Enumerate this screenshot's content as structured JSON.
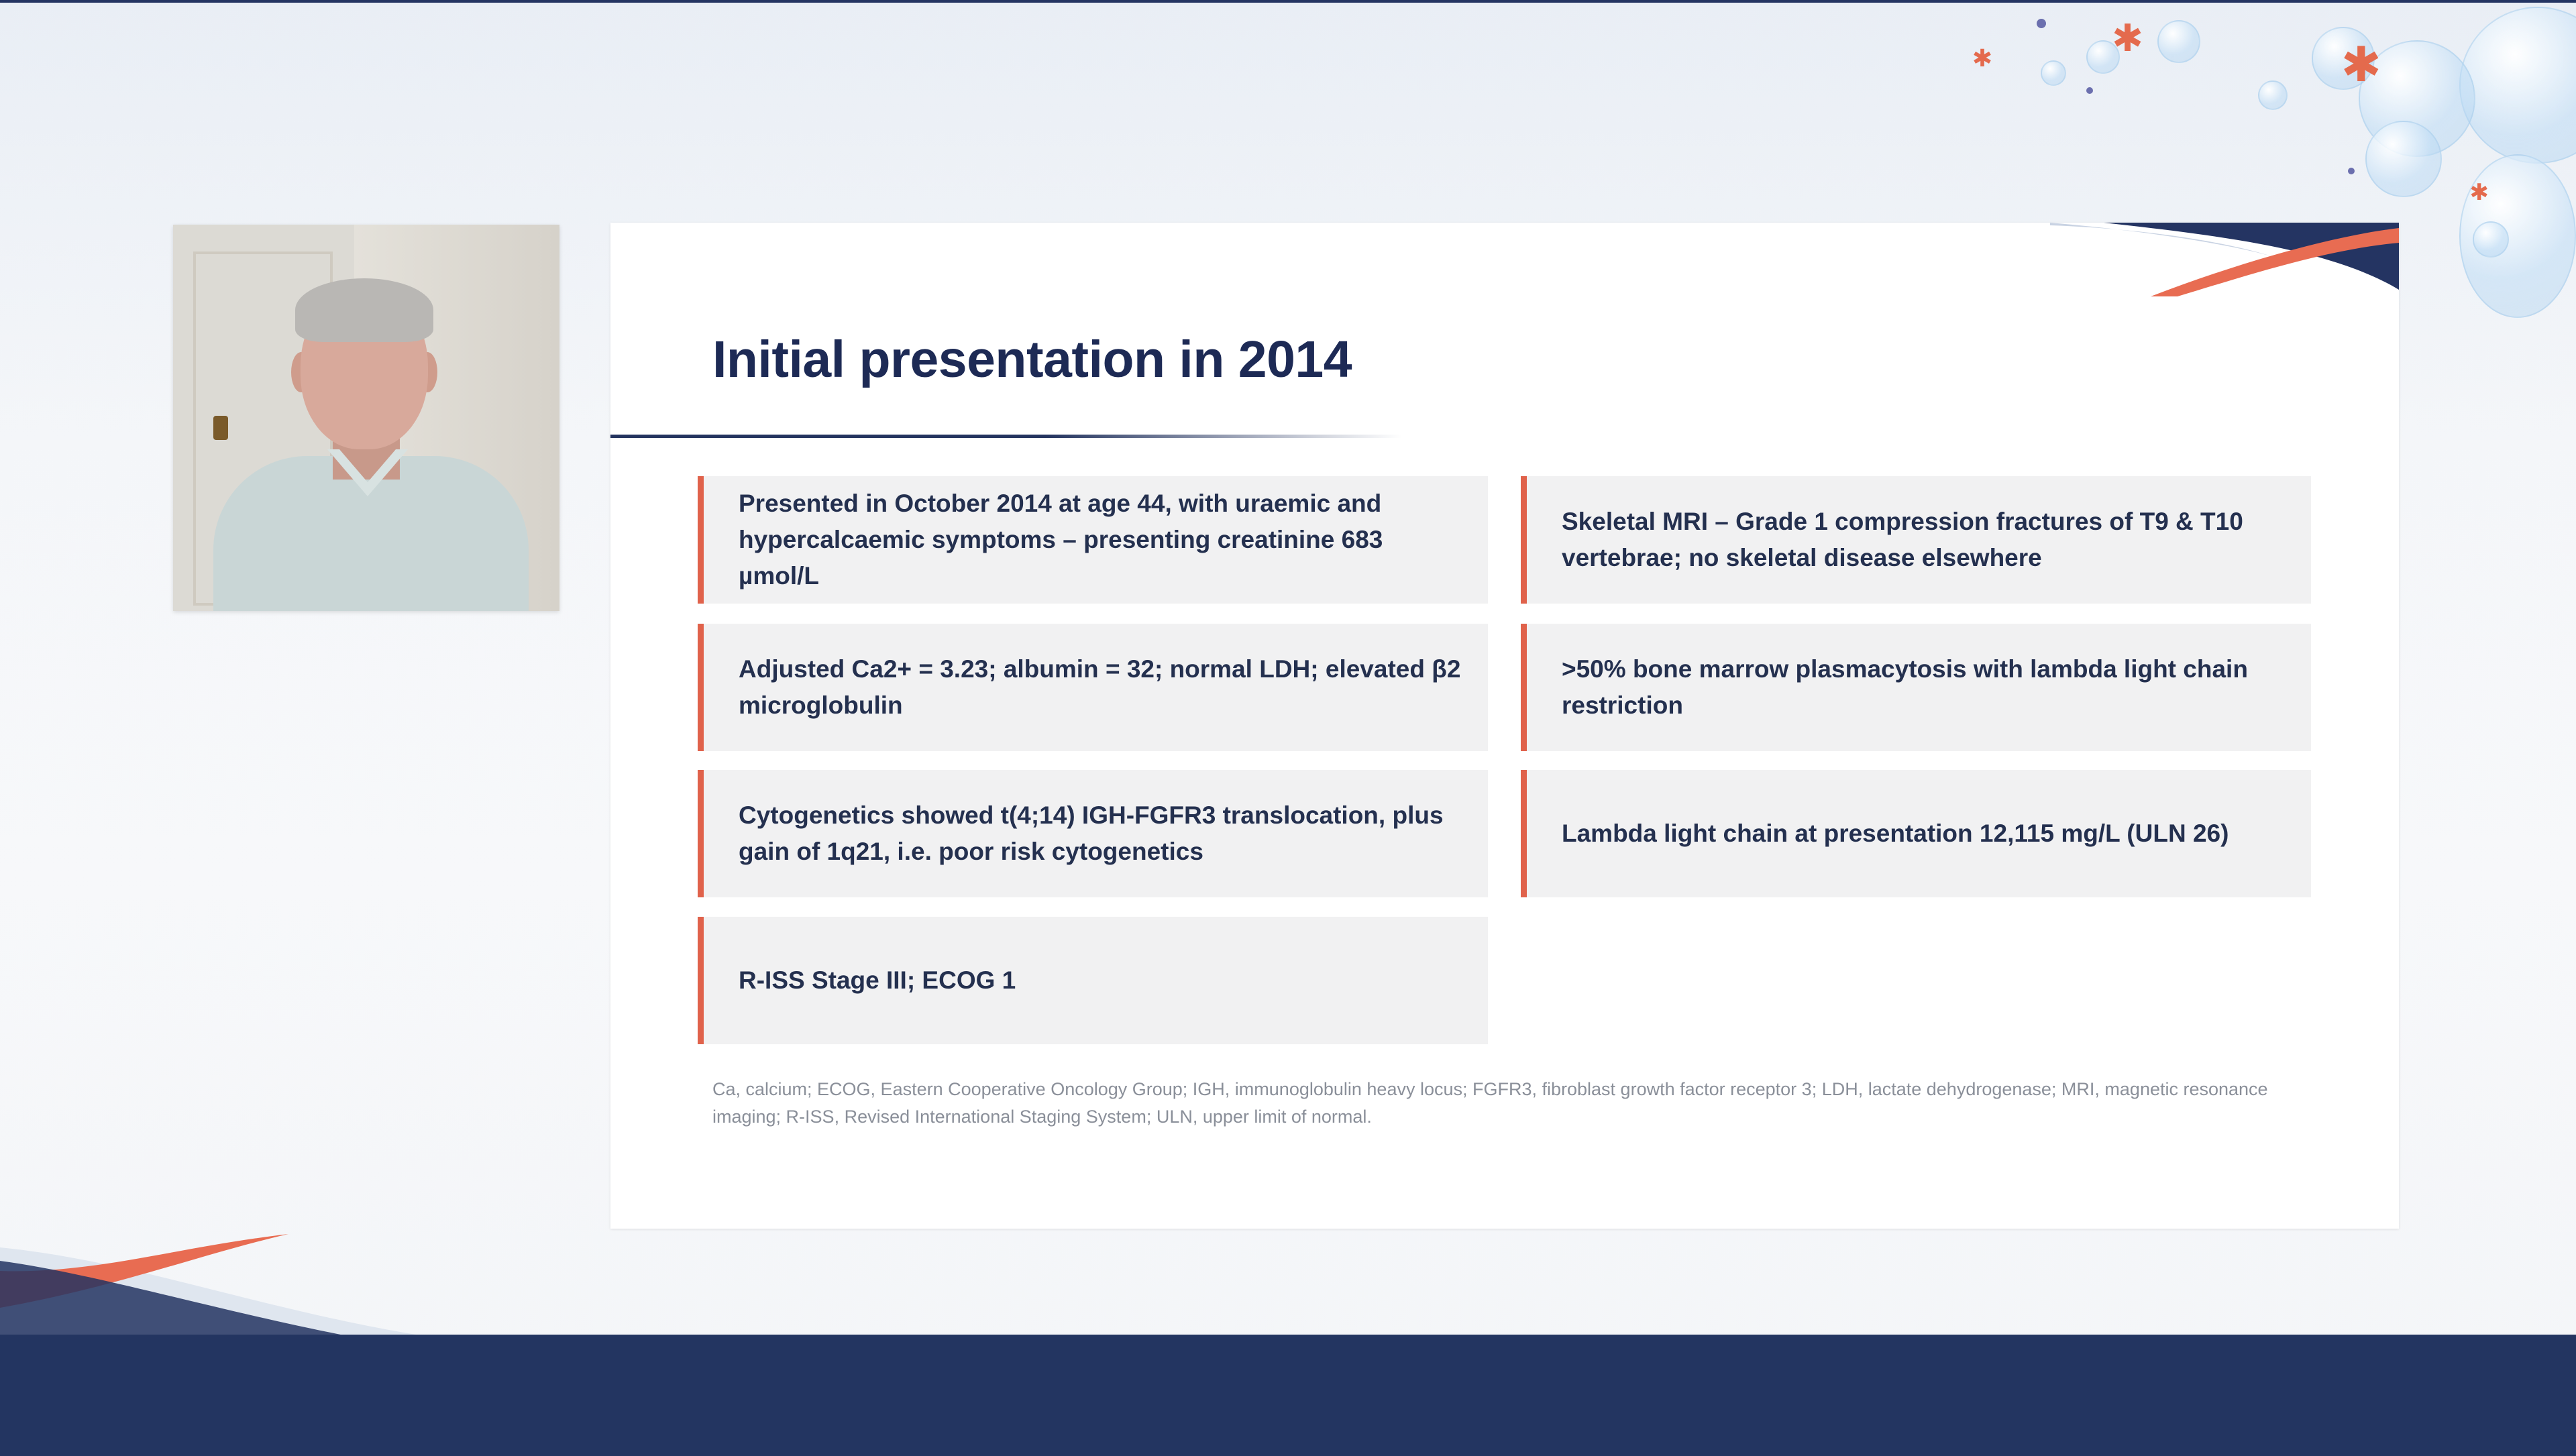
{
  "slide": {
    "title": "Initial presentation in 2014",
    "boxes": [
      "Presented in October 2014 at age 44, with uraemic and hypercalcaemic symptoms – presenting creatinine 683 µmol/L",
      "Skeletal MRI – Grade 1 compression fractures of T9 & T10 vertebrae; no skeletal disease elsewhere",
      "Adjusted Ca2+ = 3.23; albumin = 32; normal LDH; elevated β2 microglobulin",
      ">50% bone marrow plasmacytosis with lambda light chain restriction",
      "Cytogenetics showed t(4;14) IGH-FGFR3 translocation, plus gain of 1q21, i.e. poor risk cytogenetics",
      "Lambda light chain at presentation 12,115 mg/L (ULN 26)",
      "R-ISS Stage III; ECOG 1"
    ],
    "footnote": "Ca, calcium; ECOG, Eastern Cooperative Oncology Group; IGH, immunoglobulin heavy locus; FGFR3, fibroblast growth factor receptor 3; LDH, lactate dehydrogenase; MRI, magnetic resonance imaging; R-ISS, Revised International Staging System; ULN, upper limit of normal."
  },
  "colors": {
    "navy": "#233561",
    "accent": "#e0624b",
    "box_bg": "#f1f1f2",
    "title": "#1d2a55"
  },
  "icons": {
    "decor": [
      "bubble-decoration",
      "antibody-icon",
      "wave-decoration"
    ]
  }
}
